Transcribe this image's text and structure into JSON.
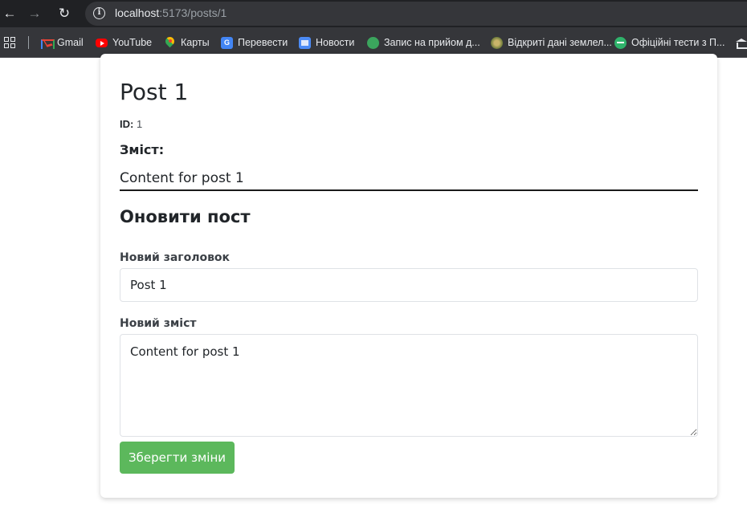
{
  "browser": {
    "url_host": "localhost",
    "url_path": ":5173/posts/1",
    "bookmarks": [
      {
        "label": "Gmail",
        "icon": "gmail-icon"
      },
      {
        "label": "YouTube",
        "icon": "youtube-icon"
      },
      {
        "label": "Карты",
        "icon": "maps-icon"
      },
      {
        "label": "Перевести",
        "icon": "translate-icon"
      },
      {
        "label": "Новости",
        "icon": "news-icon"
      },
      {
        "label": "Запис на прийом д...",
        "icon": "green-circle-icon"
      },
      {
        "label": "Відкриті дані землел...",
        "icon": "land-data-icon"
      },
      {
        "label": "Офіційні тести з П...",
        "icon": "tests-icon"
      },
      {
        "label": "",
        "icon": "bank-icon"
      }
    ]
  },
  "post": {
    "title": "Post 1",
    "id_label": "ID:",
    "id_value": "1",
    "content_label": "Зміст:",
    "content_text": "Content for post 1"
  },
  "update_form": {
    "heading": "Оновити пост",
    "title_label": "Новий заголовок",
    "title_value": "Post 1",
    "content_label": "Новий зміст",
    "content_value": "Content for post 1",
    "save_label": "Зберегти зміни"
  },
  "colors": {
    "save_button": "#5cb85c",
    "browser_bar": "#202124",
    "bookmarks_bar": "#35363a"
  }
}
